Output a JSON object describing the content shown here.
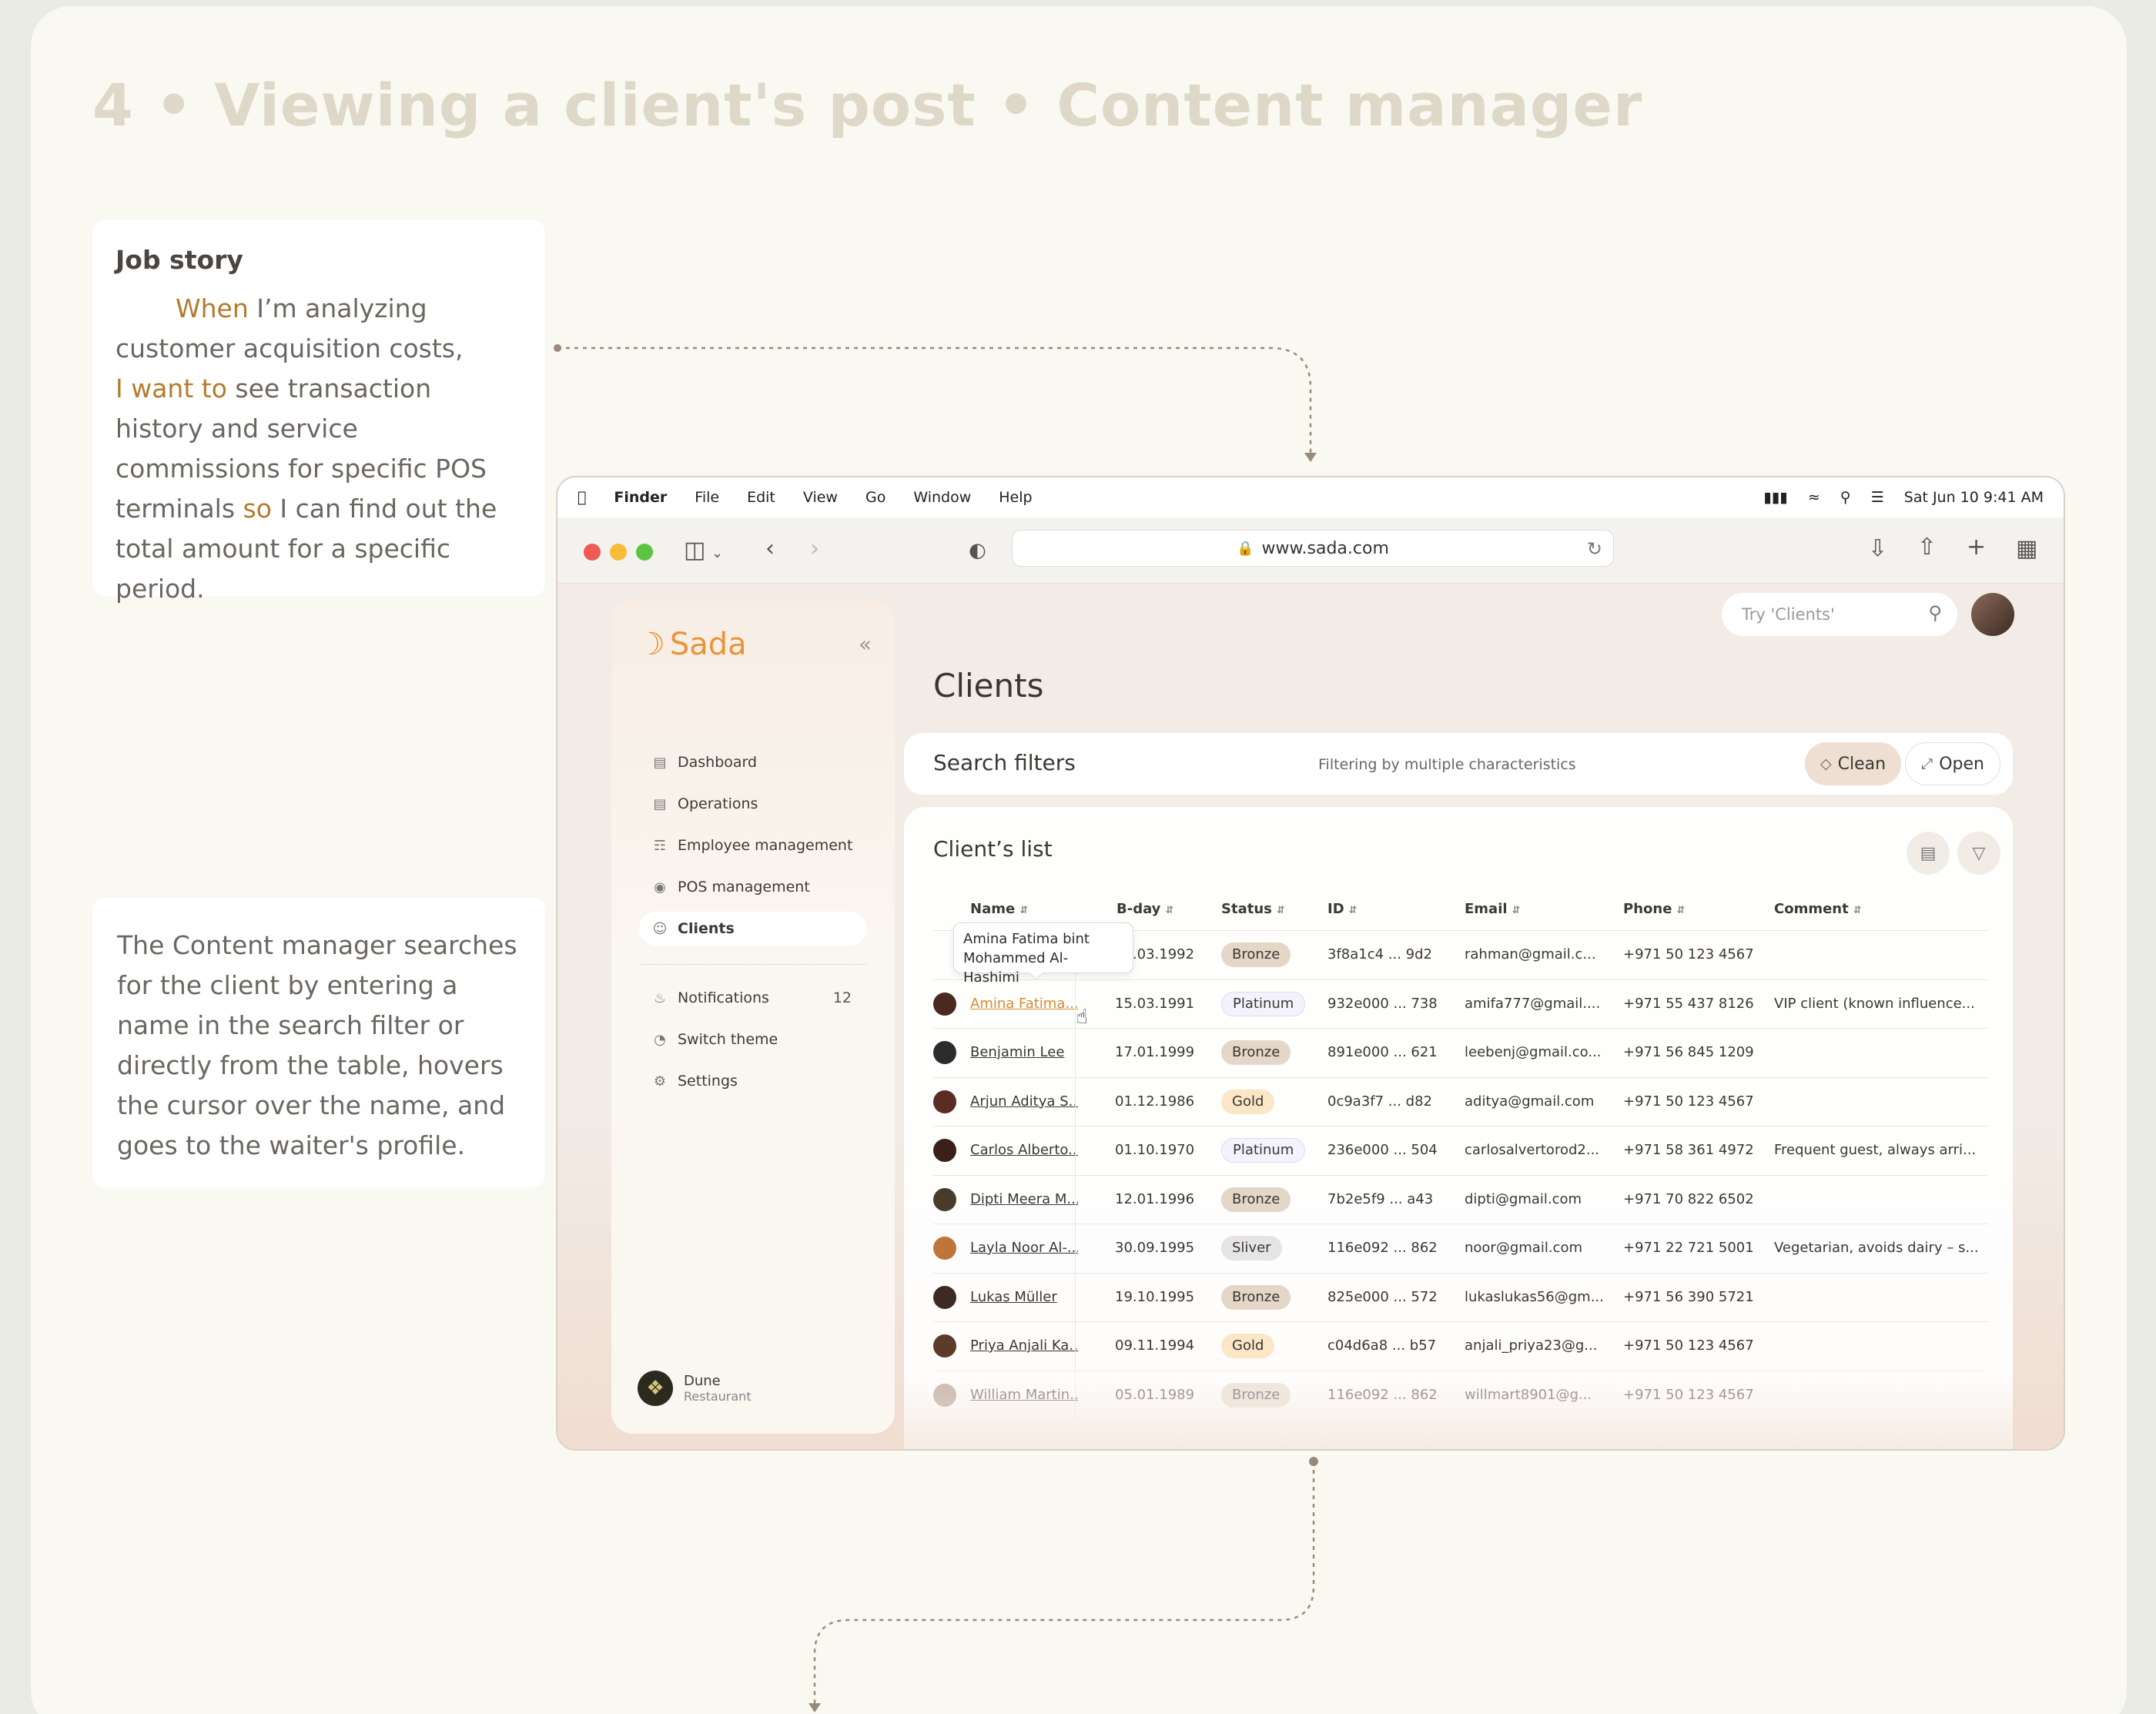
{
  "page_title": "4 • Viewing a client's post • Content manager",
  "job_story": {
    "heading": "Job story",
    "when": "When",
    "part1": " I’m analyzing customer acquisition costs,",
    "want": "I want to",
    "part2": " see transaction history and service commissions for specific POS terminals ",
    "so": "so",
    "part3": " I can find out the total amount for a specific period."
  },
  "description": "The Content manager searches for the client by entering a name in the search filter or directly from the table, hovers the cursor over the name, and goes to the waiter's profile.",
  "menubar": {
    "app": "Finder",
    "items": [
      "File",
      "Edit",
      "View",
      "Go",
      "Window",
      "Help"
    ],
    "datetime": "Sat Jun 10  9:41 AM"
  },
  "browser": {
    "url": "www.sada.com"
  },
  "sidebar": {
    "logo": "Sada",
    "nav": [
      {
        "label": "Dashboard",
        "icon": "chart-icon"
      },
      {
        "label": "Operations",
        "icon": "calendar-icon"
      },
      {
        "label": "Employee management",
        "icon": "employee-icon"
      },
      {
        "label": "POS management",
        "icon": "pos-icon"
      },
      {
        "label": "Clients",
        "icon": "clients-icon"
      }
    ],
    "secondary": [
      {
        "label": "Notifications",
        "count": "12"
      },
      {
        "label": "Switch theme"
      },
      {
        "label": "Settings"
      }
    ],
    "brand": {
      "name": "Dune",
      "subtitle": "Restaurant"
    }
  },
  "header": {
    "search_placeholder": "Try 'Clients'",
    "title": "Clients"
  },
  "filters": {
    "title": "Search filters",
    "subtitle": "Filtering by multiple characteristics",
    "clean_label": "Clean",
    "open_label": "Open"
  },
  "client_list": {
    "title": "Client’s list",
    "columns": [
      "Name",
      "B-day",
      "Status",
      "ID",
      "Email",
      "Phone",
      "Comment"
    ],
    "tooltip": "Amina Fatima bint Mohammed Al-Hashimi",
    "rows": [
      {
        "name": "",
        "bday": "15.03.1992",
        "status": "Bronze",
        "id": "3f8a1c4 ... 9d2",
        "email": "rahman@gmail.c...",
        "phone": "+971 50 123 4567",
        "comment": ""
      },
      {
        "name": "Amina Fatima...",
        "bday": "15.03.1991",
        "status": "Platinum",
        "id": "932e000 ... 738",
        "email": "amifa777@gmail....",
        "phone": "+971 55 437 8126",
        "comment": "VIP client (known influence..."
      },
      {
        "name": "Benjamin Lee",
        "bday": "17.01.1999",
        "status": "Bronze",
        "id": "891e000 ... 621",
        "email": "leebenj@gmail.co...",
        "phone": "+971 56 845 1209",
        "comment": ""
      },
      {
        "name": "Arjun Aditya S...",
        "bday": "01.12.1986",
        "status": "Gold",
        "id": "0c9a3f7 ... d82",
        "email": "aditya@gmail.com",
        "phone": "+971 50 123 4567",
        "comment": ""
      },
      {
        "name": "Carlos Alberto...",
        "bday": "01.10.1970",
        "status": "Platinum",
        "id": "236e000 ... 504",
        "email": "carlosalvertorod2...",
        "phone": "+971 58 361 4972",
        "comment": "Frequent guest, always arri..."
      },
      {
        "name": "Dipti Meera M...",
        "bday": "12.01.1996",
        "status": "Bronze",
        "id": "7b2e5f9 ... a43",
        "email": "dipti@gmail.com",
        "phone": "+971 70 822 6502",
        "comment": ""
      },
      {
        "name": "Layla Noor Al-...",
        "bday": "30.09.1995",
        "status": "Sliver",
        "id": "116e092 ... 862",
        "email": "noor@gmail.com",
        "phone": "+971 22 721 5001",
        "comment": "Vegetarian, avoids dairy – s..."
      },
      {
        "name": "Lukas Müller",
        "bday": "19.10.1995",
        "status": "Bronze",
        "id": "825e000 ... 572",
        "email": "lukaslukas56@gm...",
        "phone": "+971 56 390 5721",
        "comment": ""
      },
      {
        "name": "Priya Anjali Ka...",
        "bday": "09.11.1994",
        "status": "Gold",
        "id": "c04d6a8 ... b57",
        "email": "anjali_priya23@g...",
        "phone": "+971 50 123 4567",
        "comment": ""
      },
      {
        "name": "William Martin...",
        "bday": "05.01.1989",
        "status": "Bronze",
        "id": "116e092 ... 862",
        "email": "willmart8901@g...",
        "phone": "+971 50 123 4567",
        "comment": ""
      }
    ]
  },
  "colors": {
    "accent": "#e8953a",
    "highlight": "#b57a2d"
  }
}
